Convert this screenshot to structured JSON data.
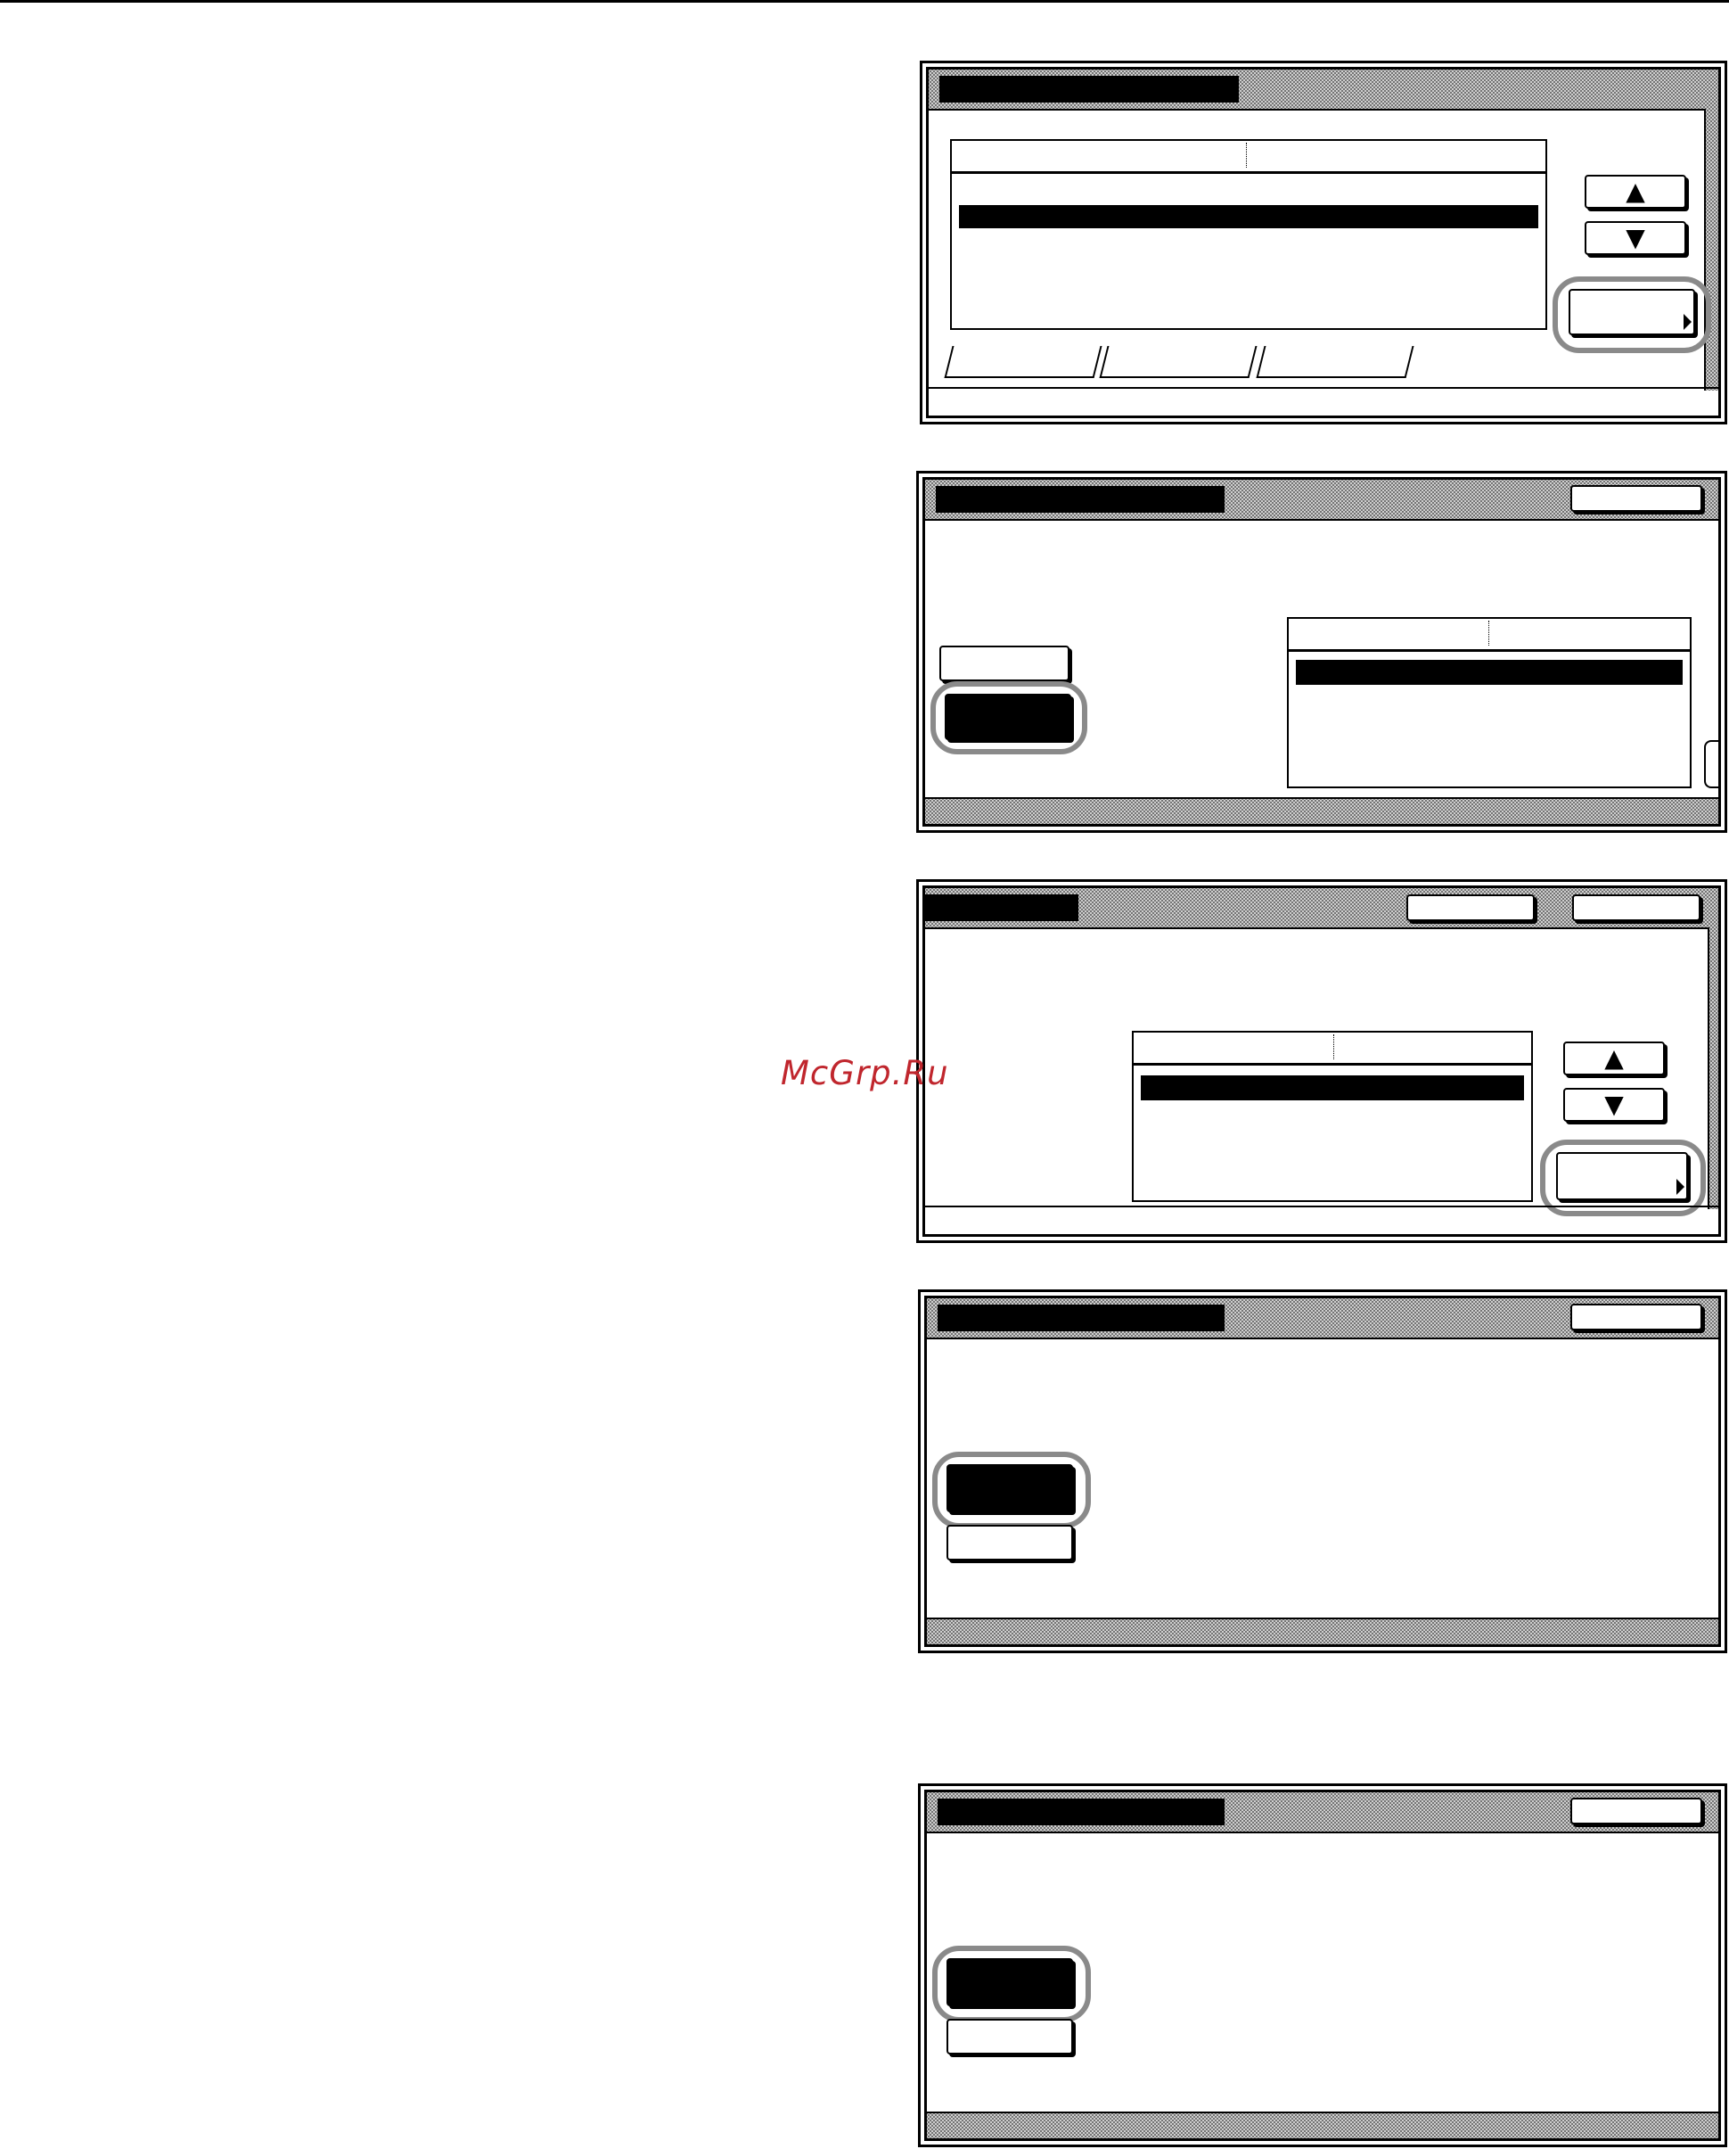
{
  "watermark": "McGrp.Ru",
  "screens": [
    {
      "name": "screen-1",
      "has_list": true,
      "has_tabs": true
    },
    {
      "name": "screen-2",
      "has_list": true
    },
    {
      "name": "screen-3",
      "has_list": true
    },
    {
      "name": "screen-4",
      "has_list": false
    },
    {
      "name": "screen-5",
      "has_list": false
    }
  ],
  "icons": {
    "scroll_up": "▲",
    "scroll_down": "▼"
  },
  "colors": {
    "highlight_ring": "#8a8a8a",
    "watermark": "#c0262d",
    "selection": "#000000"
  }
}
